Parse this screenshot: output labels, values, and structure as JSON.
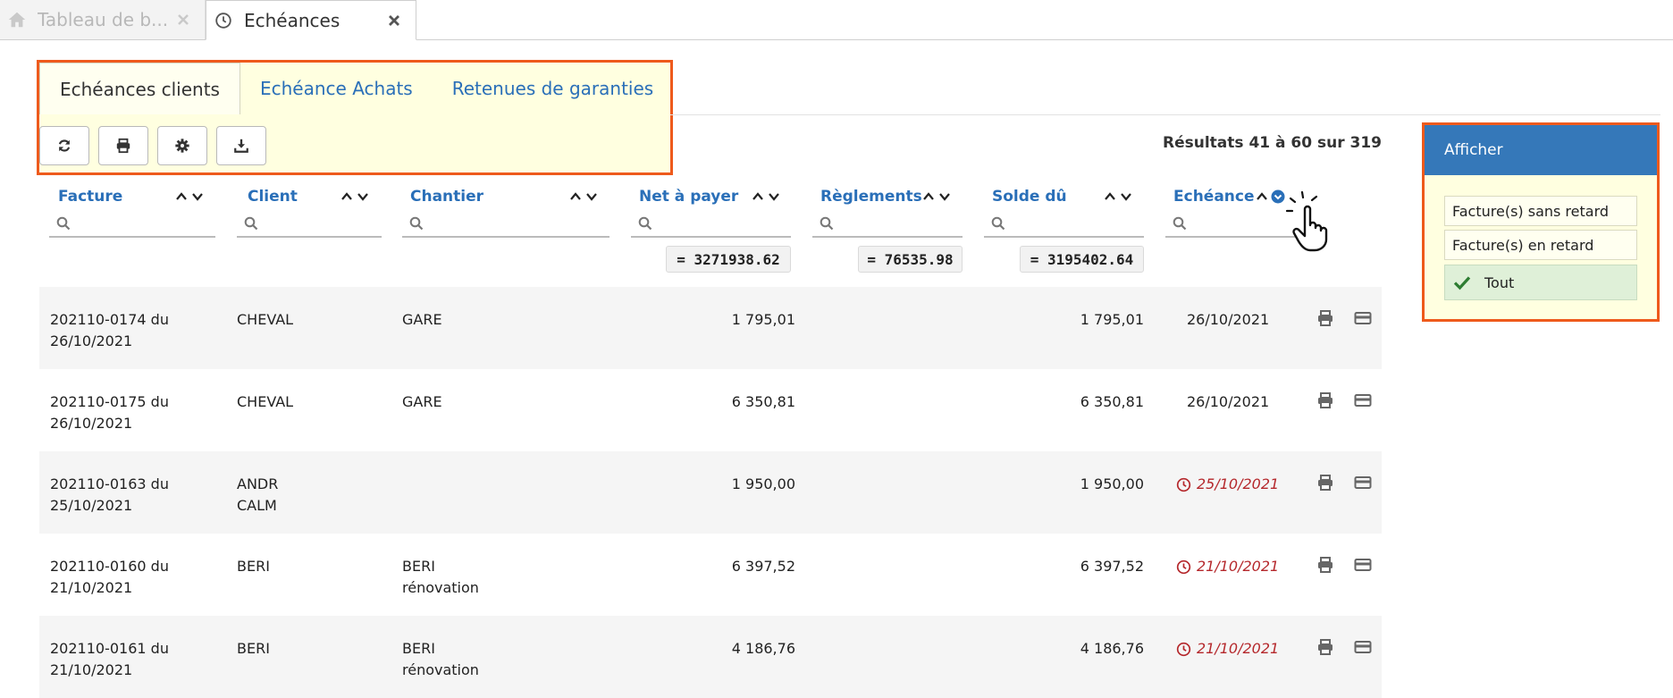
{
  "window_tabs": [
    {
      "label": "Tableau de b...",
      "icon": "home-icon",
      "active": false
    },
    {
      "label": "Echéances",
      "icon": "clock-icon",
      "active": true
    }
  ],
  "subtabs": [
    "Echéances clients",
    "Echéance Achats",
    "Retenues de garanties"
  ],
  "toolbar": {
    "buttons": [
      "refresh-icon",
      "print-icon",
      "gear-icon",
      "download-icon"
    ]
  },
  "results": "Résultats 41 à 60 sur 319",
  "columns": {
    "facture": "Facture",
    "client": "Client",
    "chantier": "Chantier",
    "net": "Net à payer",
    "reglements": "Règlements",
    "solde": "Solde dû",
    "echeance": "Echéance"
  },
  "totals": {
    "net": "= 3271938.62",
    "reglements": "= 76535.98",
    "solde": "= 3195402.64"
  },
  "rows": [
    {
      "facture": [
        "202110-0174 du",
        "26/10/2021"
      ],
      "client": [
        "CHEVAL"
      ],
      "chantier": [
        "GARE"
      ],
      "net": "1 795,01",
      "solde": "1 795,01",
      "echeance": "26/10/2021",
      "late": false
    },
    {
      "facture": [
        "202110-0175 du",
        "26/10/2021"
      ],
      "client": [
        "CHEVAL"
      ],
      "chantier": [
        "GARE"
      ],
      "net": "6 350,81",
      "solde": "6 350,81",
      "echeance": "26/10/2021",
      "late": false
    },
    {
      "facture": [
        "202110-0163 du",
        "25/10/2021"
      ],
      "client": [
        "ANDR",
        "CALM"
      ],
      "chantier": [
        ""
      ],
      "net": "1 950,00",
      "solde": "1 950,00",
      "echeance": "25/10/2021",
      "late": true
    },
    {
      "facture": [
        "202110-0160 du",
        "21/10/2021"
      ],
      "client": [
        "BERI"
      ],
      "chantier": [
        "BERI",
        "rénovation"
      ],
      "net": "6 397,52",
      "solde": "6 397,52",
      "echeance": "21/10/2021",
      "late": true
    },
    {
      "facture": [
        "202110-0161 du",
        "21/10/2021"
      ],
      "client": [
        "BERI"
      ],
      "chantier": [
        "BERI",
        "rénovation"
      ],
      "net": "4 186,76",
      "solde": "4 186,76",
      "echeance": "21/10/2021",
      "late": true
    }
  ],
  "panel": {
    "title": "Afficher",
    "options": [
      "Facture(s) sans retard",
      "Facture(s) en retard",
      "Tout"
    ],
    "selected": "Tout"
  },
  "colors": {
    "accent": "#2a6fb8",
    "highlight_border": "#ee5a1c",
    "highlight_bg": "#ffffe0",
    "late": "#b5282c",
    "panel_head": "#3578b9"
  }
}
